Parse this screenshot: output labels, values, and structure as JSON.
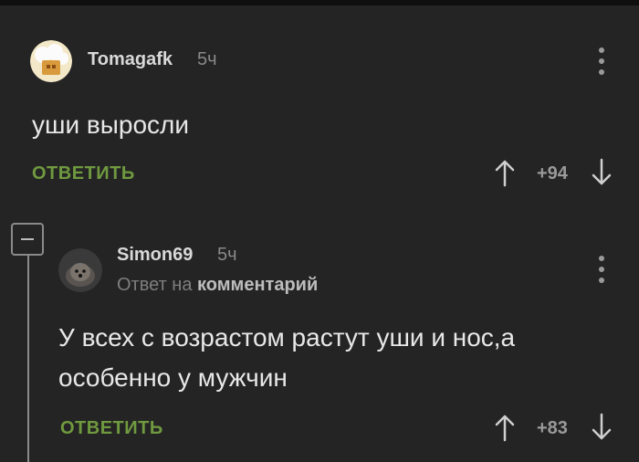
{
  "comment1": {
    "username": "Tomagafk",
    "time": "5ч",
    "text": "уши выросли",
    "reply_label": "ОТВЕТИТЬ",
    "score": "+94"
  },
  "comment2": {
    "username": "Simon69",
    "time": "5ч",
    "reply_prefix": "Ответ на",
    "reply_target": "комментарий",
    "text_line1": "У всех с возрастом растут уши и нос,а",
    "text_line2": "особенно у мужчин",
    "reply_label": "ОТВЕТИТЬ",
    "score": "+83"
  },
  "icons": {
    "upvote": "arrow-up-icon",
    "downvote": "arrow-down-icon",
    "more": "more-vertical-icon",
    "collapse": "minus-icon"
  },
  "colors": {
    "background": "#242424",
    "accent_green": "#6f9a3f"
  }
}
